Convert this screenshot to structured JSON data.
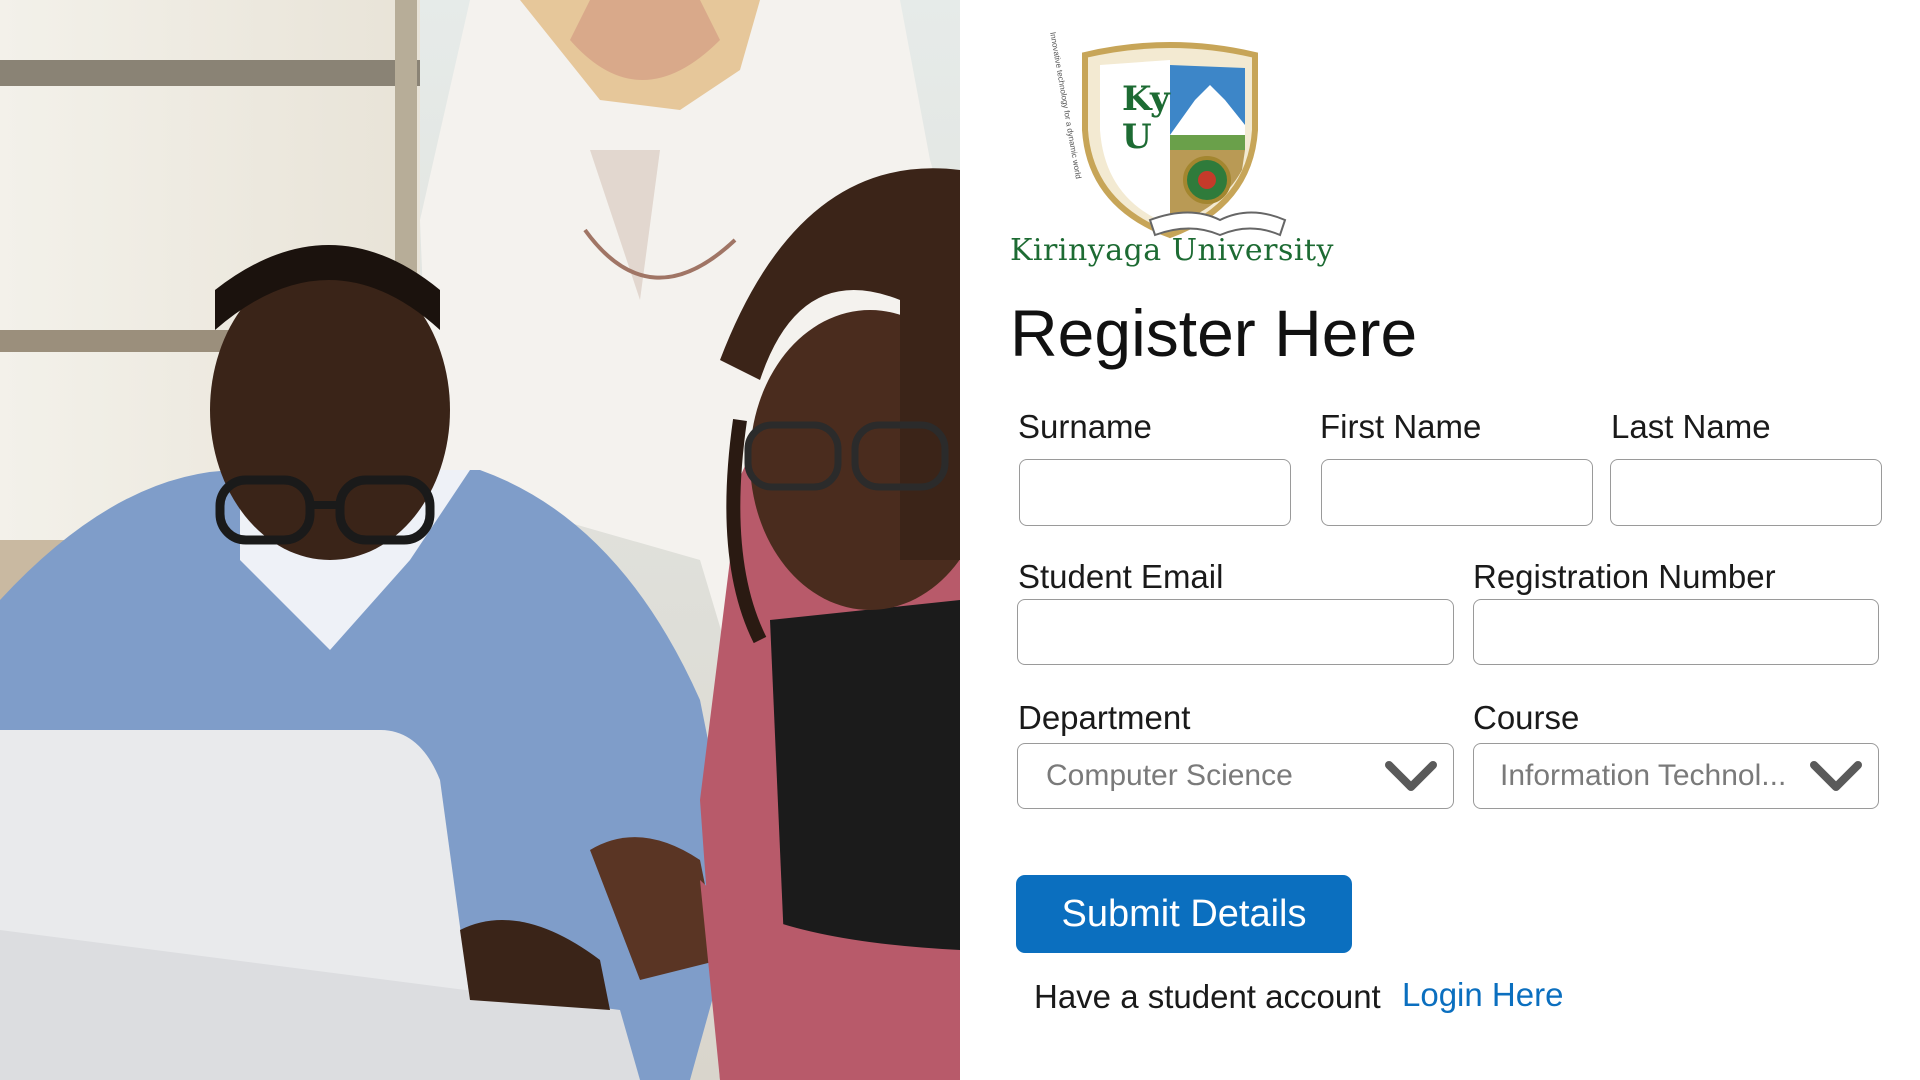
{
  "brand": {
    "logo_initials": "KyU",
    "logo_motto": "Innovative technology for a dynamic world",
    "name": "Kirinyaga University"
  },
  "form": {
    "title": "Register Here",
    "fields": {
      "surname": {
        "label": "Surname",
        "value": ""
      },
      "first_name": {
        "label": "First Name",
        "value": ""
      },
      "last_name": {
        "label": "Last Name",
        "value": ""
      },
      "student_email": {
        "label": "Student Email",
        "value": ""
      },
      "registration_number": {
        "label": "Registration Number",
        "value": ""
      },
      "department": {
        "label": "Department",
        "selected": "Computer Science"
      },
      "course": {
        "label": "Course",
        "selected": "Information Technol..."
      }
    },
    "submit_label": "Submit Details",
    "footer_text": "Have a student account",
    "login_link_label": "Login Here"
  },
  "colors": {
    "primary": "#0b6fbf",
    "brand_green": "#1d6b33",
    "input_border": "#9a9a9a"
  },
  "icons": {
    "department_dropdown": "chevron-down-icon",
    "course_dropdown": "chevron-down-icon"
  }
}
